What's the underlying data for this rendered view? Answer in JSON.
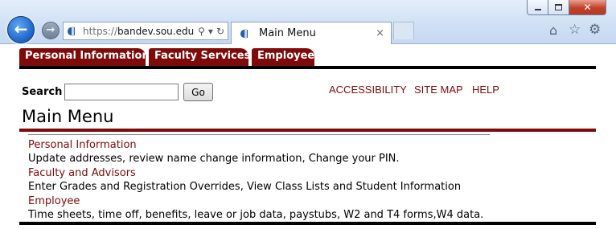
{
  "browser": {
    "address_scheme": "https://",
    "address_host": "bandev.sou.edu",
    "tab_title": "Main Menu",
    "tab_close": "×",
    "icons": [
      "back-arrow-icon",
      "forward-arrow-icon",
      "site-favicon-icon",
      "search-icon",
      "refresh-icon",
      "home-icon",
      "star-icon",
      "gear-icon"
    ]
  },
  "nav_tabs": [
    "Personal Information",
    "Faculty Services",
    "Employee"
  ],
  "search": {
    "label": "Search",
    "value": "",
    "button": "Go"
  },
  "top_links": [
    "ACCESSIBILITY",
    "SITE MAP",
    "HELP"
  ],
  "page_title": "Main Menu",
  "menu": [
    {
      "link": "Personal Information",
      "desc": "Update addresses, review name change information, Change your PIN."
    },
    {
      "link": "Faculty and Advisors",
      "desc": "Enter Grades and Registration Overrides, View Class Lists and Student Information"
    },
    {
      "link": "Employee",
      "desc": "Time sheets, time off, benefits, leave or job data, paystubs, W2 and T4 forms,W4 data."
    }
  ],
  "colors": {
    "brand": "#7e0a0a",
    "rule": "#000000"
  }
}
